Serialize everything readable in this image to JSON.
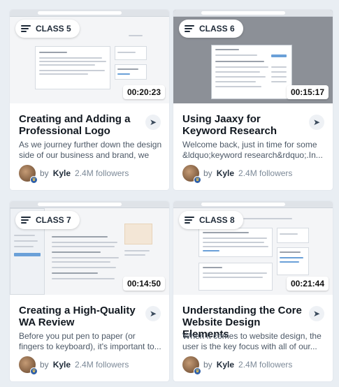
{
  "cards": [
    {
      "class_label": "CLASS 5",
      "duration": "00:20:23",
      "title": "Creating and Adding a Professional Logo",
      "description": "As we journey further down the design side of our business and brand, we find...",
      "author_prefix": "by",
      "author": "Kyle",
      "followers": "2.4M followers"
    },
    {
      "class_label": "CLASS 6",
      "duration": "00:15:17",
      "title": "Using Jaaxy for Keyword Research",
      "description": "Welcome back, just in time for some &ldquo;keyword research&rdquo;.In...",
      "author_prefix": "by",
      "author": "Kyle",
      "followers": "2.4M followers"
    },
    {
      "class_label": "CLASS 7",
      "duration": "00:14:50",
      "title": "Creating a High-Quality WA Review",
      "description": "Before you put pen to paper (or fingers to keyboard), it's important to...",
      "author_prefix": "by",
      "author": "Kyle",
      "followers": "2.4M followers"
    },
    {
      "class_label": "CLASS 8",
      "duration": "00:21:44",
      "title": "Understanding the Core Website Design Elements",
      "description": "When it comes to website design, the user is the key focus with all of our...",
      "author_prefix": "by",
      "author": "Kyle",
      "followers": "2.4M followers"
    }
  ],
  "icons": {
    "menu": "menu-icon",
    "rocket": "rocket-icon",
    "avatar_badge": "crown-icon"
  }
}
